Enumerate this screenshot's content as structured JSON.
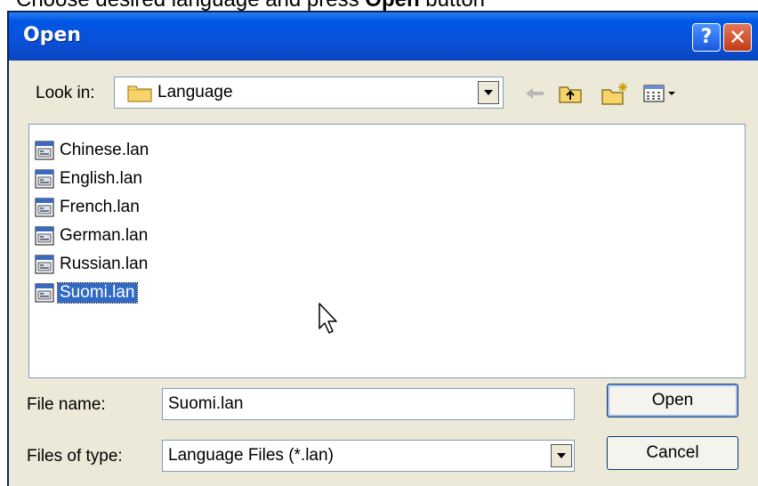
{
  "instruction": {
    "prefix": "Choose desired language and press ",
    "bold": "Open",
    "suffix": " button"
  },
  "dialog": {
    "title": "Open",
    "help_glyph": "?",
    "close_glyph": "✕"
  },
  "lookin": {
    "label": "Look in:",
    "value": "Language",
    "icon": "folder-icon"
  },
  "toolbar": {
    "icons": [
      "back-arrow-icon",
      "up-folder-icon",
      "new-folder-icon",
      "view-menu-icon"
    ]
  },
  "files": [
    {
      "name": "Chinese.lan",
      "selected": false
    },
    {
      "name": "English.lan",
      "selected": false
    },
    {
      "name": "French.lan",
      "selected": false
    },
    {
      "name": "German.lan",
      "selected": false
    },
    {
      "name": "Russian.lan",
      "selected": false
    },
    {
      "name": "Suomi.lan",
      "selected": true
    }
  ],
  "filename": {
    "label": "File name:",
    "value": "Suomi.lan"
  },
  "filetype": {
    "label": "Files of type:",
    "value": "Language Files (*.lan)"
  },
  "buttons": {
    "open": "Open",
    "cancel": "Cancel"
  },
  "colors": {
    "title_bar": "#0a50d8",
    "selection": "#316ac5",
    "dialog_bg": "#ece9d8"
  }
}
